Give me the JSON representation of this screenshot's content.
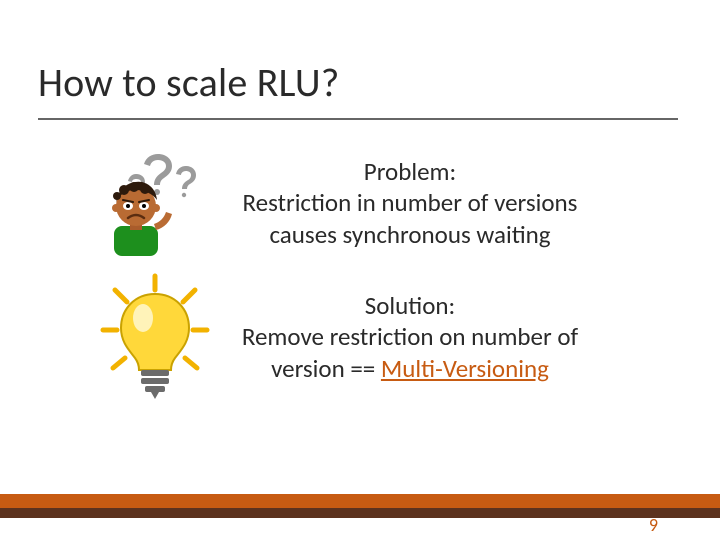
{
  "title": "How to scale RLU?",
  "problem": {
    "heading": "Problem:",
    "line1": "Restriction in number of versions",
    "line2": "causes synchronous waiting"
  },
  "solution": {
    "heading": "Solution:",
    "line1": "Remove restriction on number of",
    "line2_prefix": "version == ",
    "highlight": "Multi-Versioning"
  },
  "page_number": "9",
  "colors": {
    "accent": "#C75B12"
  }
}
